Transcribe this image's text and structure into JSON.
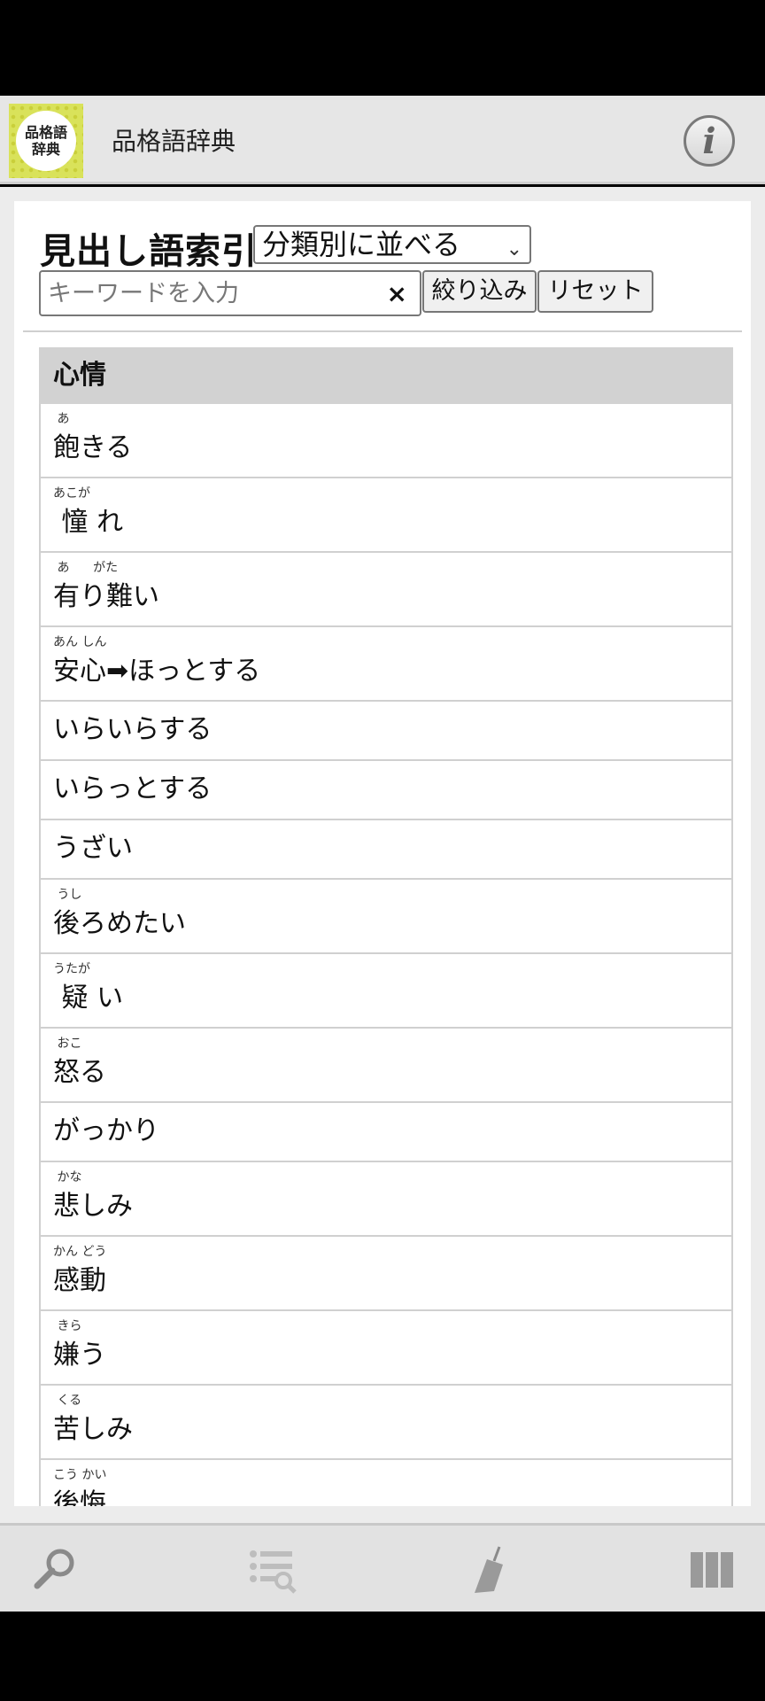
{
  "app": {
    "logo_text": "品格語\n辞典",
    "title": "品格語辞典",
    "info_glyph": "i"
  },
  "index": {
    "heading": "見出し語索引",
    "sort_selected": "分類別に並べる",
    "search_placeholder": "キーワードを入力",
    "search_value": "",
    "clear_glyph": "×",
    "filter_label": "絞り込み",
    "reset_label": "リセット"
  },
  "group": {
    "title": "心情",
    "entries": [
      {
        "reading": " あ",
        "word": "飽きる"
      },
      {
        "reading": "あこが",
        "word": " 憧 れ"
      },
      {
        "reading": " あ      がた",
        "word": "有り難い"
      },
      {
        "reading": "あん しん",
        "word": "安心➡ほっとする"
      },
      {
        "reading": "",
        "word": "いらいらする"
      },
      {
        "reading": "",
        "word": "いらっとする"
      },
      {
        "reading": "",
        "word": "うざい"
      },
      {
        "reading": " うし",
        "word": "後ろめたい"
      },
      {
        "reading": "うたが",
        "word": " 疑 い"
      },
      {
        "reading": " おこ",
        "word": "怒る"
      },
      {
        "reading": "",
        "word": "がっかり"
      },
      {
        "reading": " かな",
        "word": "悲しみ"
      },
      {
        "reading": "かん どう",
        "word": "感動"
      },
      {
        "reading": " きら",
        "word": "嫌う"
      },
      {
        "reading": " くる",
        "word": "苦しみ"
      },
      {
        "reading": "こう かい",
        "word": "後悔"
      }
    ]
  },
  "bottom_tabs": [
    {
      "icon": "search-icon"
    },
    {
      "icon": "list-search-icon"
    },
    {
      "icon": "broom-icon"
    },
    {
      "icon": "columns-icon"
    }
  ]
}
